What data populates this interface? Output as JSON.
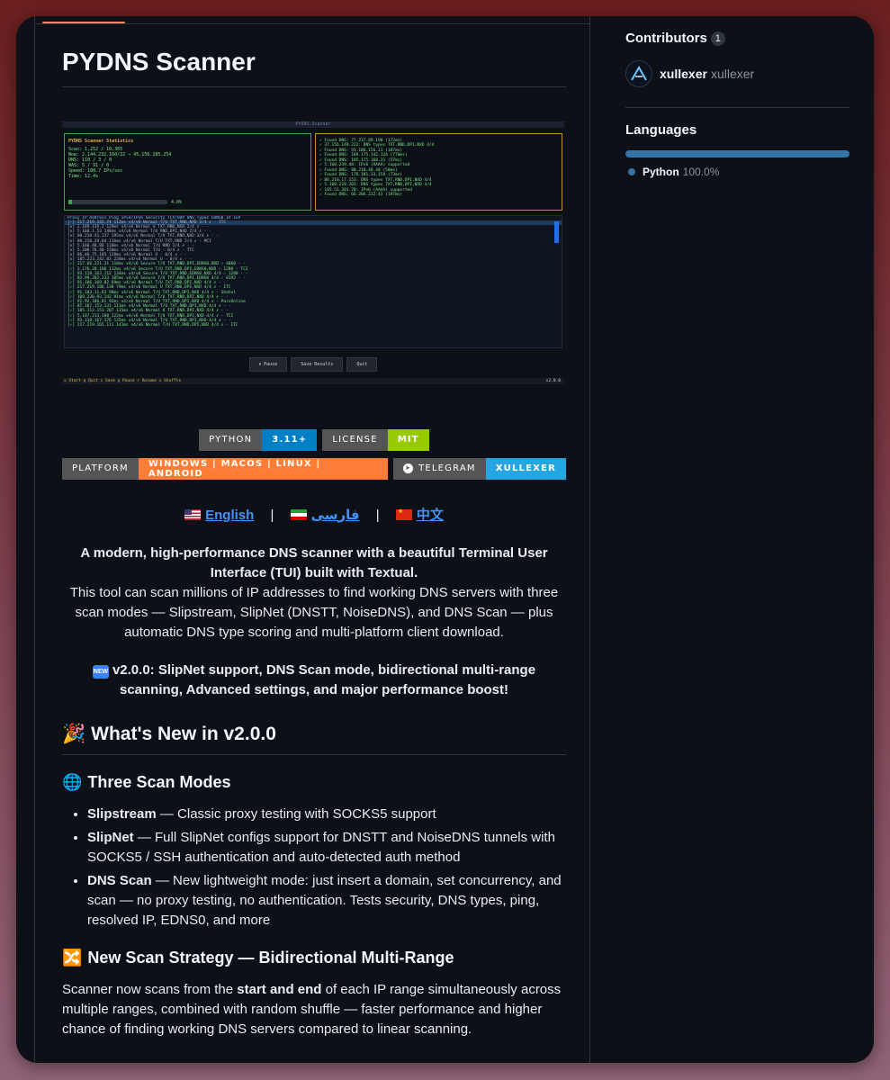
{
  "readme": {
    "title": "PYDNS Scanner",
    "terminal": {
      "window_title": "PYDNS-Scanner",
      "stats_heading": "PYDNS Scanner Statistics",
      "stats_lines": [
        "Scan: 1,252 / 10,365",
        "Now: 2.144.232.160/22 → 45.156.185.254",
        "DNS: 110 / 3 / 0",
        "WAS: 5 / 91 / 0",
        "Speed: 100.7 IPs/sec",
        "Time: 12.4s"
      ],
      "progress_label": "4.0%",
      "log_lines": [
        "✓ Found DNS: 77.237.89.190 (172ms)",
        "✓ 37.156.149.222: DNS types TXT,RND,DPI,NXD 4/4",
        "✓ Found DNS: 91.106.156.21 (107ms)",
        "✓ Found DNS: 109.175.142.124 (770ms)",
        "✓ Found DNS: 185.175.168.31 (57ms)",
        "✓ 5.160.239.48: IPv6 (AAAA) supported",
        "✓ Found DNS: 80.210.48.48 (50ms)",
        "✓ Found DNS: 176.101.33.158 (73ms)",
        "✓ 86.210.17.153: DNS types TXT,RND,DPI,NXD 4/4",
        "✓ 5.160.228.201: DNS types TXT,RND,DPI,NXD 4/4",
        "✓ 185.51.201.70: IPv6 (AAAA) supported",
        "✓ Found DNS: 66.206.232.43 (197ms)"
      ],
      "table_header": "Proxy  IP Address        Ping    IPv4/IPv6  Security  TCP/UDP  DNS Types             EDNS0  IP   ISP",
      "table_rows": [
        "[-]    217.219.165.74    112ms   v4/v6      Normal    T/U      TXT,RND,NXD 3/4       ✗      -    ITC",
        "[x]    2.189.139.2       129ms   v4/v6      Normal    U        TXT,RND,NXD 2/4       ✗      -    -",
        "[x]    5.160.1.53        148ms   v4/v6      Normal    T/U      RND,DPI,NXD 2/4       ✗      -    -",
        "[x]    80.210.41.137     195ms   v4/v6      Normal    T/U      TXT,RND,NXD 3/4       ✗      -    -",
        "[x]    80.210.29.84      116ms   v4/v6      Normal    T/U      TXT,RND 2/4           ✗      -    MCI",
        "[x]    5.160.48.86       118ms   v4/v6      Normal    T/U      RND 1/4               ✗      -    -",
        "[x]    5.200.76.40       150ms   v4/v6      Normal    T/U      - 0/4                 ✗      -    TTC",
        "[x]    86.40.75.185      128ms   v4/v6      Normal    U        - 0/4                 ✗      -    -",
        "[x]    185.223.242.83    228ms   v4/v6      Normal    U        - 0/4                 ✗      -    -",
        "[✓]    217.66.221.31     118ms   v4/v6      Secure    T/U      TXT,RND,DPI,EDNS0,NXD ✓ 4060 -    -",
        "[✓]    2.176.20.106      112ms   v4/v6      Secure    T/U      TXT,RND,DPI,EDNS0,NXD ✓ 1280 -    TCI",
        "[✓]    93.118.163.112    134ms   v4/v6      Secure    T/U      TXT,RND,EDNS0,NXD 4/4 ✓ 1280 -    -",
        "[✓]    82.99.202.233     105ms   v4/v6      Secure    T/U      TXT,RND,DPI,EDNS0 4/4 ✓ 8192 -    -",
        "[✓]    91.106.169.82     69ms    v4/v6      Normal    T/U      TXT,RND,DPI,NXD 4/4   ✗      -    -",
        "[✓]    217.219.186.138   79ms    v4/v6      Normal    U        TXT,RND,DPI,NXD 4/4   ✗      -    ITC",
        "[✓]    91.103.11.63      98ms    v4/v6      Normal    T/U      TXT,RND,DPI,NXD 4/4   ✗      -    Shatel",
        "[✓]    109.230.93.142    91ms    v4/v6      Normal    T/U      TXT,RND,DPI,NXD 4/4   ✗      -    -",
        "[✓]    91.92.186.81      92ms    v4/v6      Normal    T/U      TXT,RND,DPI,NXD 4/4   ✗      -    ParsOnline",
        "[✓]    87.107.153.131    111ms   v4/v6      Normal    T/U      TXT,RND,DPI,NXD 4/4   ✗      -    -",
        "[✓]    185.112.151.207   115ms   v4/v6      Normal    U        TXT,RND,DPI,NXD 4/4   ✗      -    -",
        "[✓]    5.187.213.188     122ms   v4/v6      Normal    T/U      TXT,RND,DPI,NXD 4/4   ✗      -    TCI",
        "[✓]    93.118.167.176    135ms   v4/v6      Normal    T/U      TXT,RND,DPI,NXD 4/4   ✗      -    -",
        "[✓]    217.219.165.111   141ms   v4/v6      Normal    T/U      TXT,RND,DPI,NXD 4/4   ✗      -    ITC"
      ],
      "buttons": [
        "⏸ Pause",
        "Save Results",
        "Quit"
      ],
      "footer": "s Start  q Quit  c Save  p Pause  r Resume  x Shuffle",
      "version": "v2.0.0"
    },
    "badges": {
      "python_label": "PYTHON",
      "python_value": "3.11+",
      "license_label": "LICENSE",
      "license_value": "MIT",
      "platform_label": "PLATFORM",
      "platform_value": "WINDOWS | MACOS | LINUX | ANDROID",
      "telegram_label": "TELEGRAM",
      "telegram_value": "XULLEXER",
      "colors": {
        "label": "#555555",
        "python": "#007ec6",
        "mit": "#97ca00",
        "platform": "#fe7d37",
        "telegram": "#26a5e4"
      }
    },
    "languages": {
      "english": "English",
      "farsi": "فارسی",
      "chinese": "中文",
      "separator": "|"
    },
    "intro_bold": "A modern, high-performance DNS scanner with a beautiful Terminal User Interface (TUI) built with Textual.",
    "intro_text": "This tool can scan millions of IP addresses to find working DNS servers with three scan modes — Slipstream, SlipNet (DNSTT, NoiseDNS), and DNS Scan — plus automatic DNS type scoring and multi-platform client download.",
    "news_tag": "NEW",
    "news_text": "v2.0.0: SlipNet support, DNS Scan mode, bidirectional multi-range scanning, Advanced settings, and major performance boost!",
    "whats_new_emoji": "🎉",
    "whats_new_heading": "What's New in v2.0.0",
    "scan_modes_emoji": "🌐",
    "scan_modes_heading": "Three Scan Modes",
    "modes": [
      {
        "name": "Slipstream",
        "desc": " — Classic proxy testing with SOCKS5 support"
      },
      {
        "name": "SlipNet",
        "desc": " — Full SlipNet configs support for DNSTT and NoiseDNS tunnels with SOCKS5 / SSH authentication and auto-detected auth method"
      },
      {
        "name": "DNS Scan",
        "desc": " — New lightweight mode: just insert a domain, set concurrency, and scan — no proxy testing, no authentication. Tests security, DNS types, ping, resolved IP, EDNS0, and more"
      }
    ],
    "strategy_emoji": "🔀",
    "strategy_heading": "New Scan Strategy — Bidirectional Multi-Range",
    "strategy_pre": "Scanner now scans from the ",
    "strategy_bold": "start and end",
    "strategy_post": " of each IP range simultaneously across multiple ranges, combined with random shuffle — faster performance and higher chance of finding working DNS servers compared to linear scanning."
  },
  "sidebar": {
    "contributors_heading": "Contributors",
    "contributors_count": "1",
    "contributor_login": "xullexer",
    "contributor_name": "xullexer",
    "languages_heading": "Languages",
    "language_name": "Python",
    "language_percent": "100.0%",
    "language_share": 1.0,
    "language_color": "#3572A5"
  }
}
